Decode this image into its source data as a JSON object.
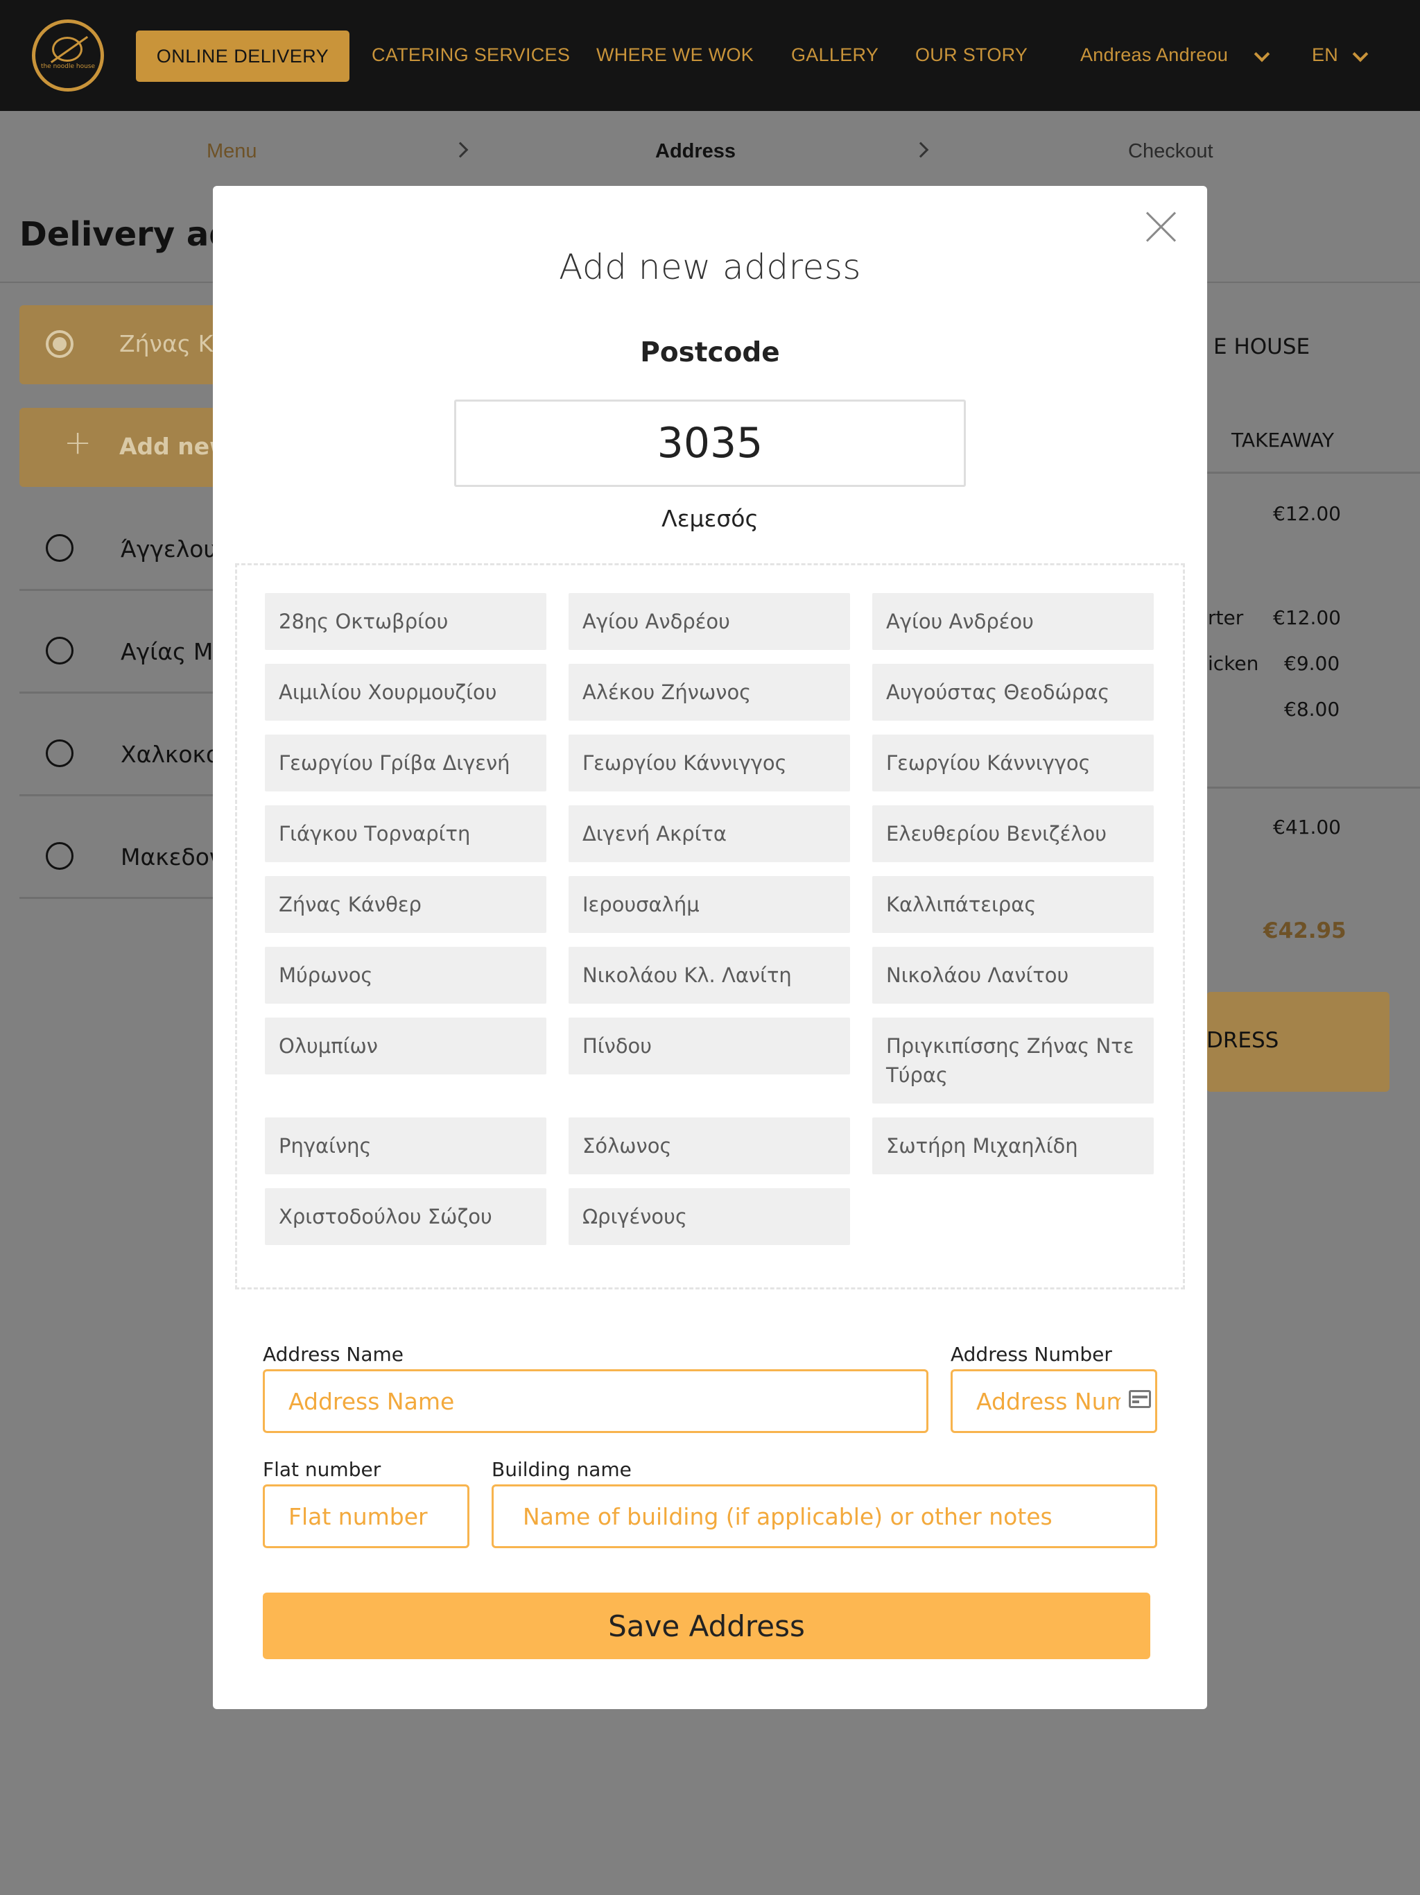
{
  "nav": {
    "logo_text": "the noodle house",
    "active_item": "ONLINE DELIVERY",
    "links": [
      "CATERING SERVICES",
      "WHERE WE WOK",
      "GALLERY",
      "OUR STORY"
    ],
    "user": "Andreas Andreou",
    "language": "EN"
  },
  "breadcrumb": {
    "steps": [
      "Menu",
      "Address",
      "Checkout"
    ]
  },
  "background": {
    "title": "Delivery add",
    "selected_address": "Ζήνας Κά",
    "add_new": "Add new",
    "saved_addresses": [
      "Άγγελου",
      "Αγίας Μα",
      "Χαλκοκον",
      "Μακεδον"
    ],
    "order": {
      "restaurant_fragment": "E HOUSE",
      "mode": "TAKEAWAY",
      "items": [
        {
          "name": "",
          "price": "€12.00"
        },
        {
          "name": "rter",
          "price": "€12.00"
        },
        {
          "name": "icken",
          "price": "€9.00"
        },
        {
          "name": "",
          "price": "€8.00"
        }
      ],
      "subtotal": "€41.00",
      "total": "€42.95",
      "cta_fragment": "DRESS"
    }
  },
  "modal": {
    "title": "Add new address",
    "postcode_label": "Postcode",
    "postcode_value": "3035",
    "city": "Λεμεσός",
    "streets": [
      "28ης Οκτωβρίου",
      "Αγίου Ανδρέου",
      "Αγίου Ανδρέου",
      "Αιμιλίου Χουρμουζίου",
      "Αλέκου Ζήνωνος",
      "Αυγούστας Θεοδώρας",
      "Γεωργίου Γρίβα Διγενή",
      "Γεωργίου Κάννιγγος",
      "Γεωργίου Κάννιγγος",
      "Γιάγκου Τορναρίτη",
      "Διγενή Ακρίτα",
      "Ελευθερίου Βενιζέλου",
      "Ζήνας Κάνθερ",
      "Ιερουσαλήμ",
      "Καλλιπάτειρας",
      "Μύρωνος",
      "Νικολάου Κλ. Λανίτη",
      "Νικολάου Λανίτου",
      "Ολυμπίων",
      "Πίνδου",
      "Πριγκιπίσσης Ζήνας Ντε Τύρας",
      "Ρηγαίνης",
      "Σόλωνος",
      "Σωτήρη Μιχαηλίδη",
      "Χριστοδούλου Σώζου",
      "Ωριγένους"
    ],
    "fields": {
      "address_name_label": "Address Name",
      "address_name_placeholder": "Address Name",
      "address_number_label": "Address Number",
      "address_number_placeholder": "Address Number",
      "flat_number_label": "Flat number",
      "flat_number_placeholder": "Flat number",
      "building_name_label": "Building name",
      "building_name_placeholder": "Name of building (if applicable) or other notes"
    },
    "save_label": "Save Address"
  },
  "colors": {
    "accent": "#c9943a",
    "button": "#fdb751",
    "field_border": "#f8b44e",
    "overlay": "#808080",
    "nav_bg": "#141414"
  }
}
